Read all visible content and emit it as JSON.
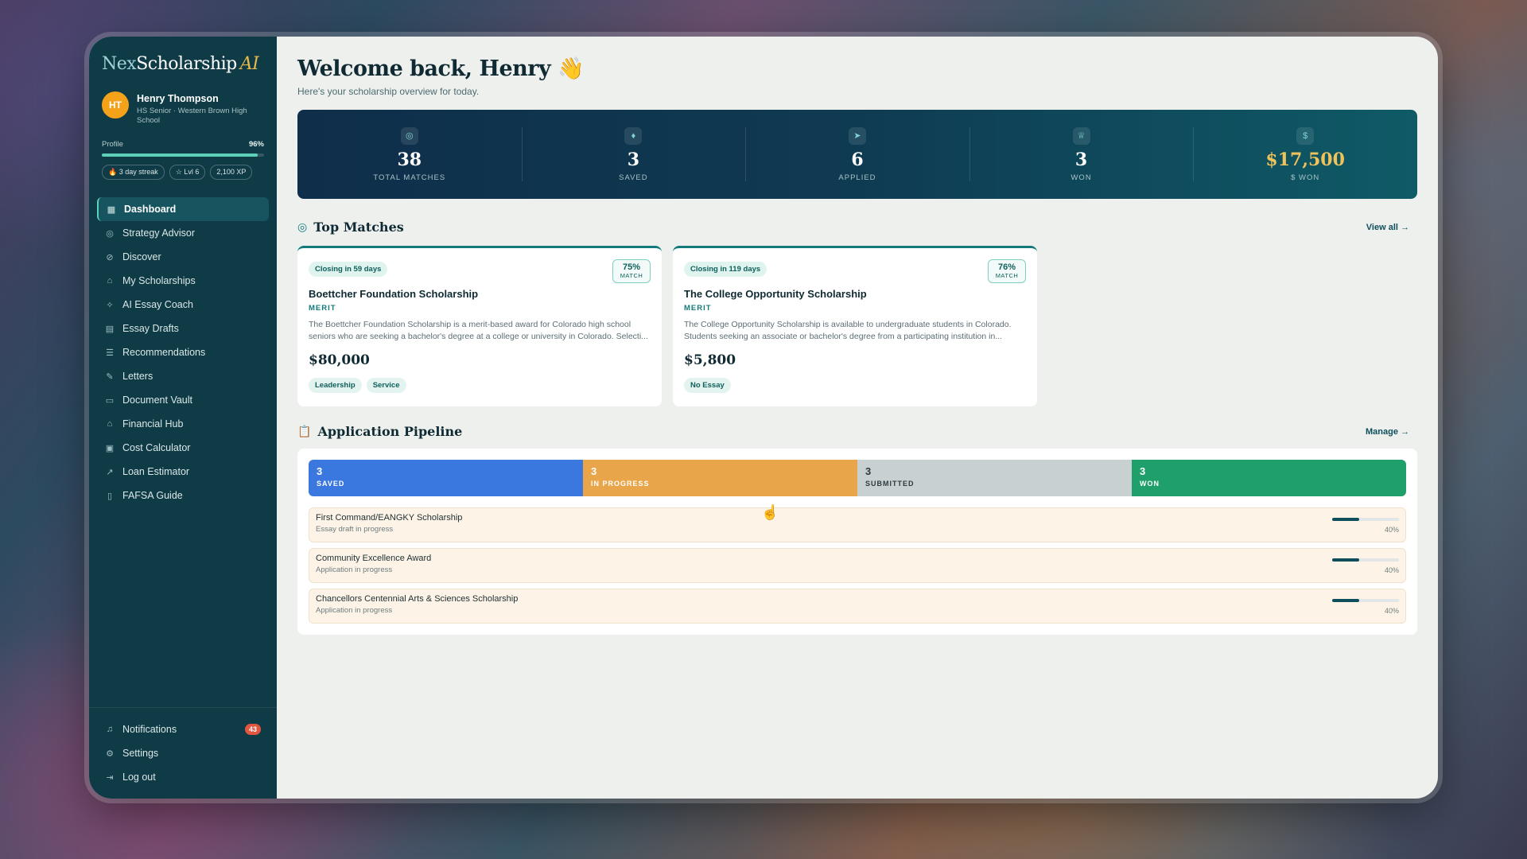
{
  "app": {
    "logo_nex": "Nex",
    "logo_scholarship": "Scholarship",
    "logo_ai": "AI"
  },
  "user": {
    "initials": "HT",
    "name": "Henry Thompson",
    "subtitle": "HS Senior · Western Brown High School",
    "profile_label": "Profile",
    "profile_pct": "96%",
    "profile_value": 0.96,
    "chips": [
      "3 day streak",
      "Lvl 6",
      "2,100 XP"
    ]
  },
  "nav": {
    "items": [
      {
        "label": "Dashboard",
        "icon": "grid-icon",
        "active": true
      },
      {
        "label": "Strategy Advisor",
        "icon": "target-icon"
      },
      {
        "label": "Discover",
        "icon": "compass-icon"
      },
      {
        "label": "My Scholarships",
        "icon": "graduation-cap-icon"
      },
      {
        "label": "AI Essay Coach",
        "icon": "wand-icon"
      },
      {
        "label": "Essay Drafts",
        "icon": "document-icon"
      },
      {
        "label": "Recommendations",
        "icon": "list-check-icon"
      },
      {
        "label": "Letters",
        "icon": "pen-icon"
      },
      {
        "label": "Document Vault",
        "icon": "archive-icon"
      },
      {
        "label": "Financial Hub",
        "icon": "bank-icon"
      },
      {
        "label": "Cost Calculator",
        "icon": "calculator-icon"
      },
      {
        "label": "Loan Estimator",
        "icon": "trend-icon"
      },
      {
        "label": "FAFSA Guide",
        "icon": "book-icon"
      }
    ],
    "bottom": [
      {
        "label": "Notifications",
        "icon": "bell-icon",
        "badge": "43"
      },
      {
        "label": "Settings",
        "icon": "gear-icon"
      },
      {
        "label": "Log out",
        "icon": "logout-icon"
      }
    ]
  },
  "header": {
    "title": "Welcome back, Henry 👋",
    "subtitle": "Here's your scholarship overview for today."
  },
  "stats": [
    {
      "value": "38",
      "label": "TOTAL MATCHES",
      "icon": "target-icon"
    },
    {
      "value": "3",
      "label": "SAVED",
      "icon": "bookmark-icon"
    },
    {
      "value": "6",
      "label": "APPLIED",
      "icon": "send-icon"
    },
    {
      "value": "3",
      "label": "WON",
      "icon": "trophy-icon"
    },
    {
      "value": "$17,500",
      "label": "$ WON",
      "icon": "dollar-icon"
    }
  ],
  "top_matches": {
    "title": "Top Matches",
    "view_all": "View all →",
    "cards": [
      {
        "closing": "Closing in 59 days",
        "match_pct": "75%",
        "match_label": "MATCH",
        "title": "Boettcher Foundation Scholarship",
        "category": "MERIT",
        "description": "The Boettcher Foundation Scholarship is a merit-based award for Colorado high school seniors who are seeking a bachelor's degree at a college or university in Colorado. Selecti...",
        "amount": "$80,000",
        "tags": [
          "Leadership",
          "Service"
        ]
      },
      {
        "closing": "Closing in 119 days",
        "match_pct": "76%",
        "match_label": "MATCH",
        "title": "The College Opportunity Scholarship",
        "category": "MERIT",
        "description": "The College Opportunity Scholarship is available to undergraduate students in Colorado. Students seeking an associate or bachelor's degree from a participating institution in...",
        "amount": "$5,800",
        "tags": [
          "No Essay"
        ]
      }
    ]
  },
  "pipeline": {
    "title": "Application Pipeline",
    "manage": "Manage →",
    "stages": [
      {
        "count": "3",
        "label": "SAVED",
        "color": "#3a78e0"
      },
      {
        "count": "3",
        "label": "IN PROGRESS",
        "color": "#e8a54a"
      },
      {
        "count": "3",
        "label": "SUBMITTED",
        "color": "#c8d0d2"
      },
      {
        "count": "3",
        "label": "WON",
        "color": "#1fa06a"
      }
    ],
    "rows": [
      {
        "name": "First Command/EANGKY Scholarship",
        "status": "Essay draft in progress",
        "pct": "40%",
        "value": 0.4
      },
      {
        "name": "Community Excellence Award",
        "status": "Application in progress",
        "pct": "40%",
        "value": 0.4
      },
      {
        "name": "Chancellors Centennial Arts & Sciences Scholarship",
        "status": "Application in progress",
        "pct": "40%",
        "value": 0.4
      }
    ]
  },
  "colors": {
    "sidebar": "#0f3b47",
    "accent": "#127a7a",
    "gold": "#f0c25a"
  }
}
